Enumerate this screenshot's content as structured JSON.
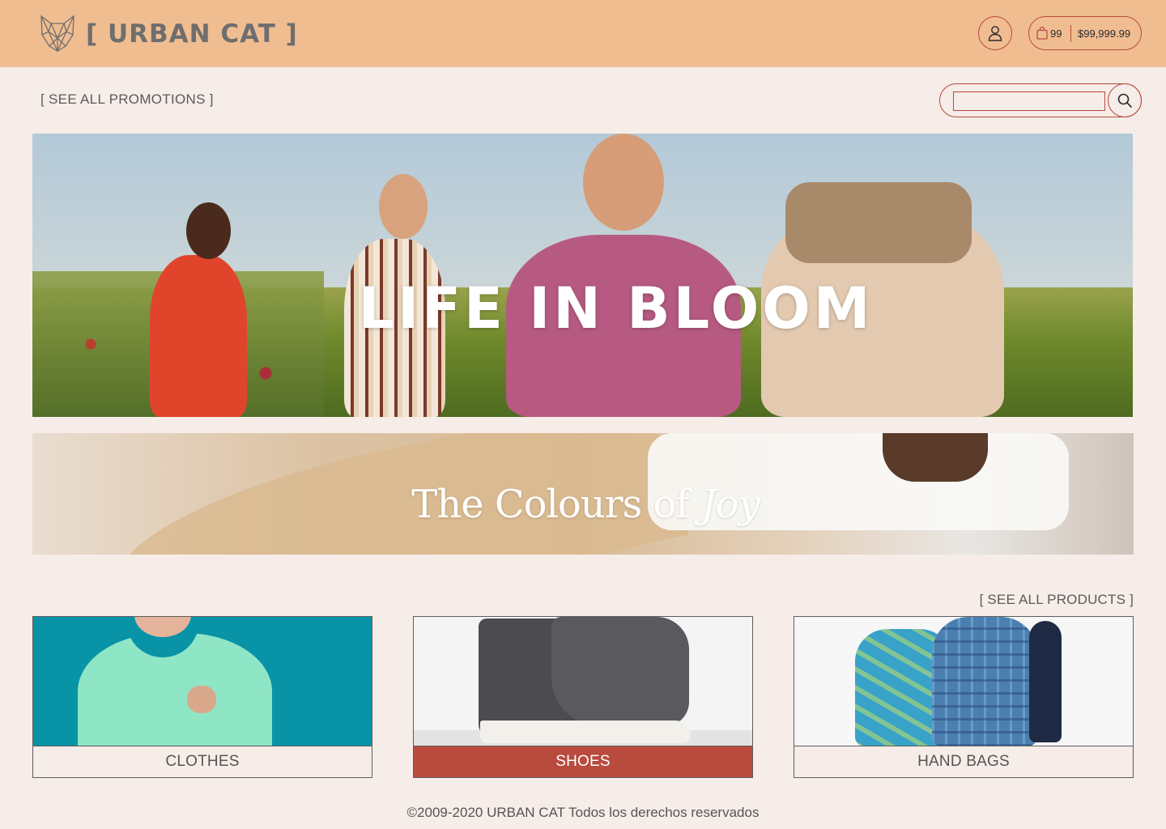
{
  "header": {
    "brand": "[ URBAN CAT ]",
    "cart_count": "99",
    "cart_total": "$99,999.99",
    "colors": {
      "background": "#f0bd91",
      "accent": "#b84a3e"
    }
  },
  "nav": {
    "promotions_link": "[ SEE ALL PROMOTIONS  ]",
    "search_placeholder": ""
  },
  "hero": {
    "title": "LIFE IN BLOOM"
  },
  "banner": {
    "title_main": "The Colours of ",
    "title_em": "Joy"
  },
  "products": {
    "see_all": "[ SEE ALL PRODUCTS ]",
    "categories": [
      {
        "label": "CLOTHES",
        "active": false
      },
      {
        "label": "SHOES",
        "active": true
      },
      {
        "label": "HAND BAGS",
        "active": false
      }
    ]
  },
  "footer": {
    "copyright": "©2009-2020 URBAN CAT Todos los derechos reservados"
  },
  "theme": {
    "page_bg": "#f6ece8",
    "selected_card": "#b84a3e"
  }
}
